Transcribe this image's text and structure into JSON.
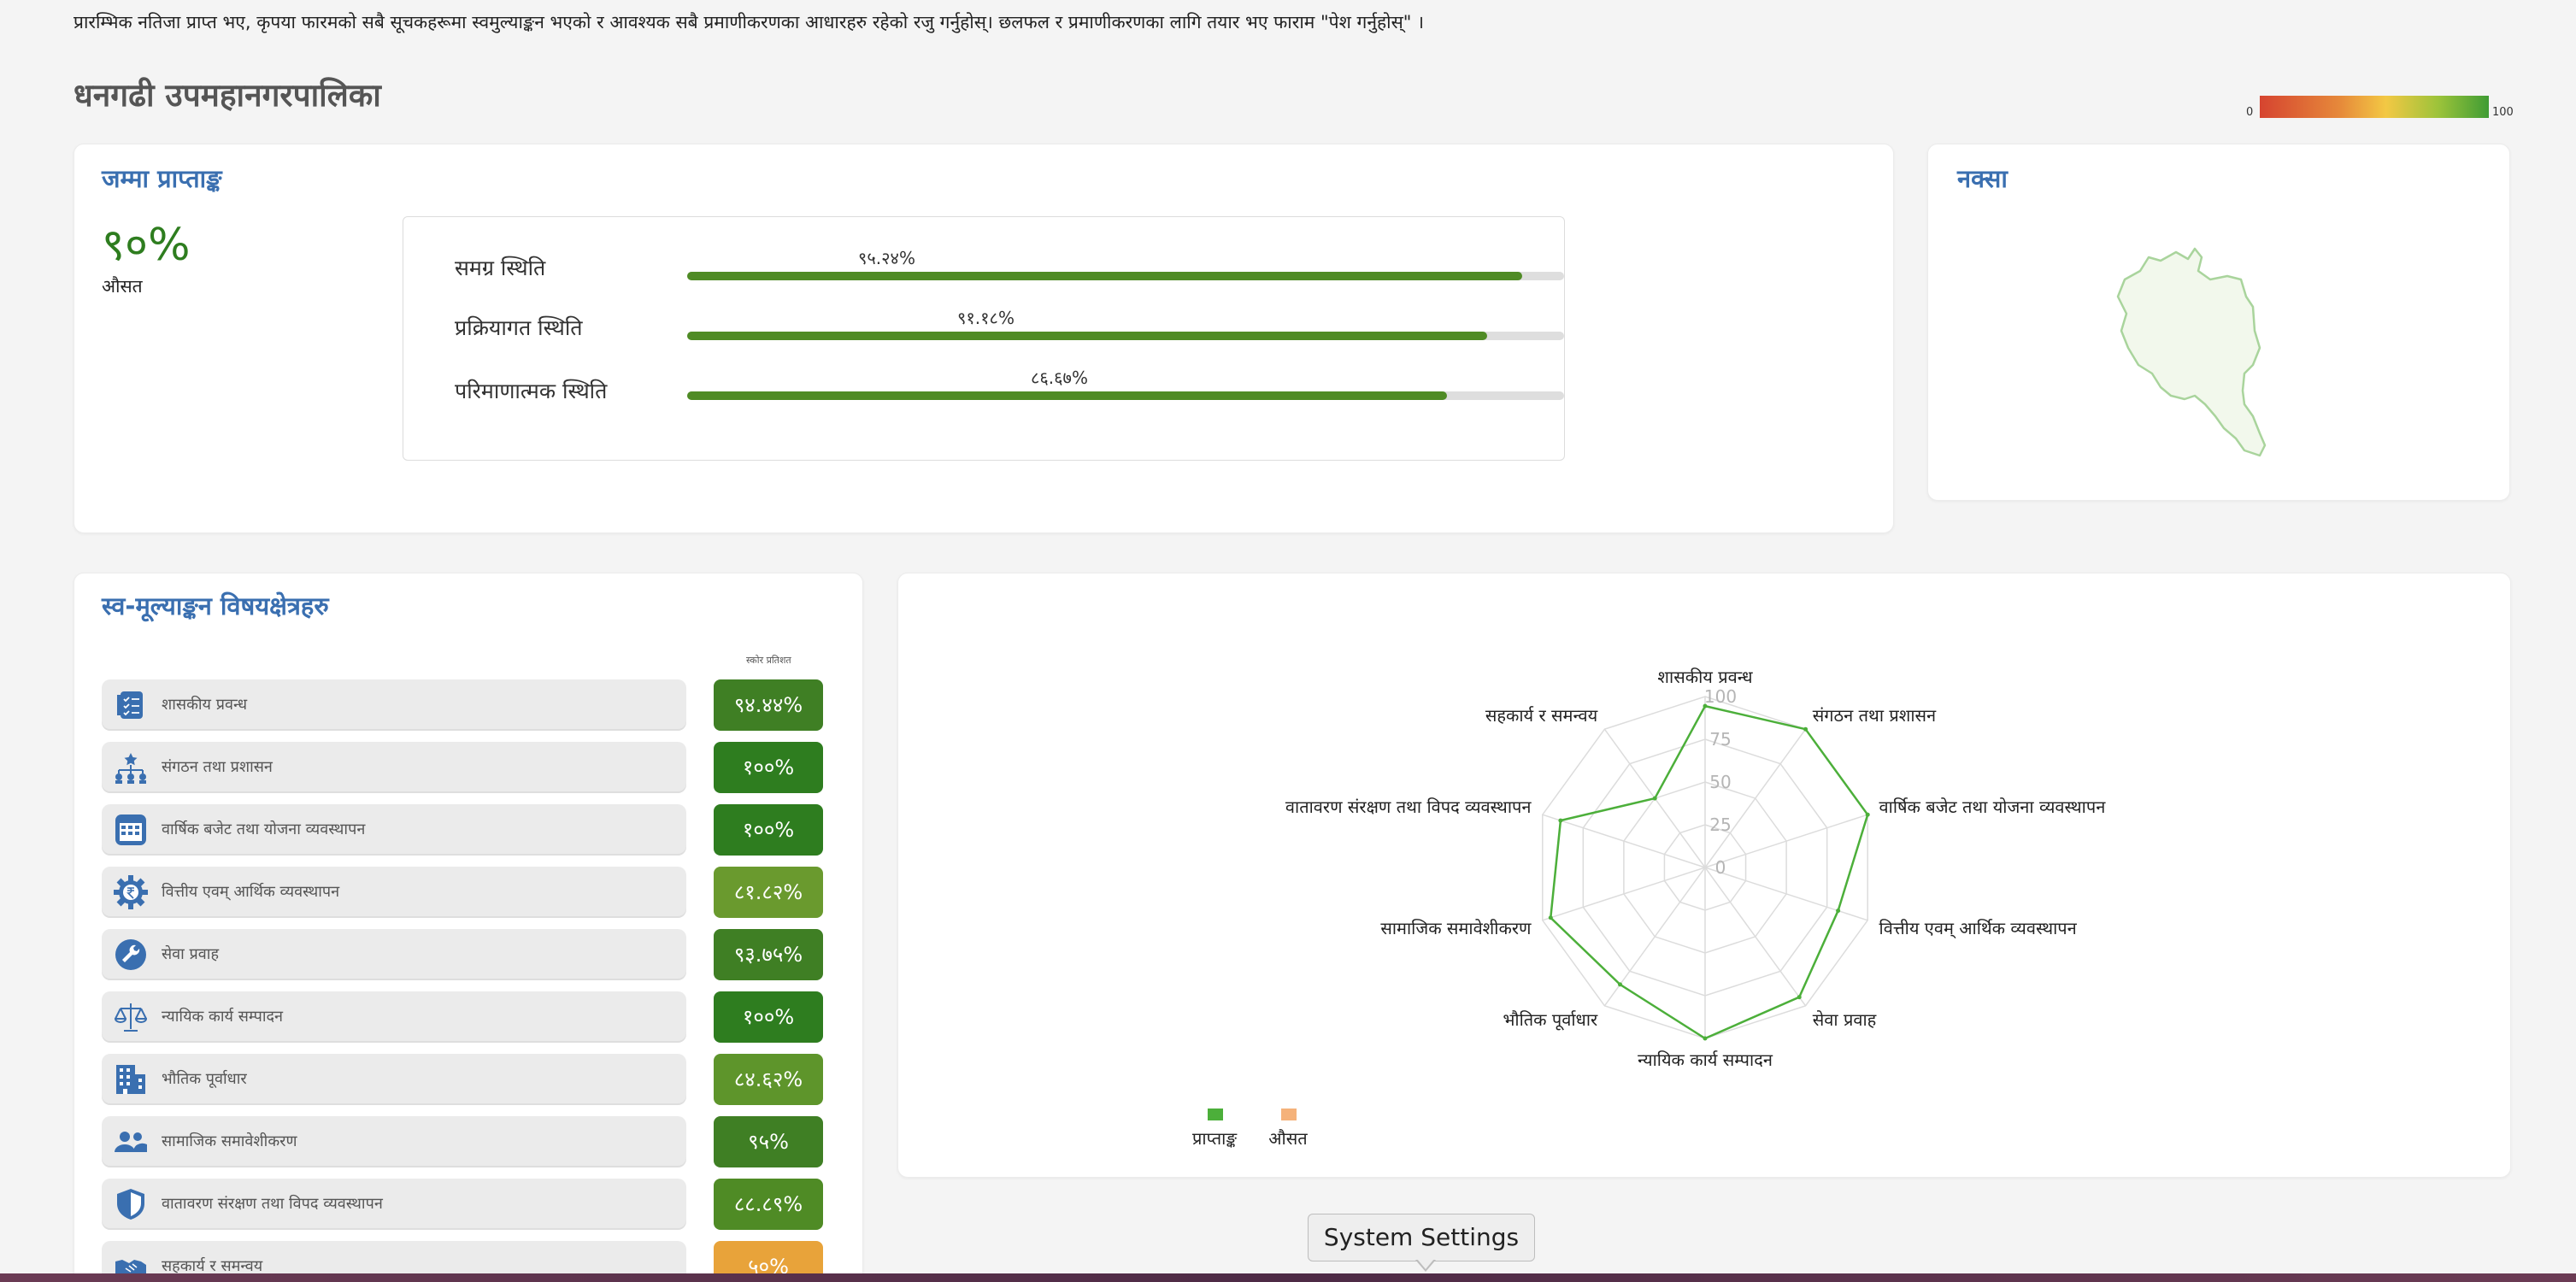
{
  "notice": "प्रारम्भिक नतिजा प्राप्त भए, कृपया फारमको सबै सूचकहरूमा स्वमुल्याङ्कन भएको र आवश्यक सबै प्रमाणीकरणका आधारहरु रहेको रजु गर्नुहोस्। छलफल र प्रमाणीकरणका लागि तयार भए फाराम \"पेश गर्नुहोस्\" ।",
  "page_title": "धनगढी उपमहानगरपालिका",
  "scale": {
    "min_label": "0",
    "max_label": "100",
    "low_color": "#d64430",
    "high_color": "#3f9c34"
  },
  "total_card": {
    "title": "जम्मा प्राप्ताङ्क",
    "score": "९०%",
    "score_caption": "औसत",
    "bars": [
      {
        "label": "समग्र स्थिति",
        "value_text": "९५.२४%",
        "value": 95.24
      },
      {
        "label": "प्रक्रियागत स्थिति",
        "value_text": "९१.१८%",
        "value": 91.18
      },
      {
        "label": "परिमाणात्मक स्थिति",
        "value_text": "८६.६७%",
        "value": 86.67
      }
    ]
  },
  "map_card": {
    "title": "नक्सा"
  },
  "areas_card": {
    "title": "स्व-मूल्याङ्कन विषयक्षेत्रहरु",
    "column_header": "स्कोर प्रतिशत",
    "items": [
      {
        "label": "शासकीय प्रवन्ध",
        "score": "९४.४४%",
        "value": 94.44,
        "icon": "governance-checklist-icon",
        "color": "#3f7f24"
      },
      {
        "label": "संगठन तथा प्रशासन",
        "score": "१००%",
        "value": 100,
        "icon": "org-chart-icon",
        "color": "#2e7d1f"
      },
      {
        "label": "वार्षिक बजेट तथा योजना व्यवस्थापन",
        "score": "१००%",
        "value": 100,
        "icon": "calendar-icon",
        "color": "#2e7d1f"
      },
      {
        "label": "वित्तीय एवम् आर्थिक व्यवस्थापन",
        "score": "८१.८२%",
        "value": 81.82,
        "icon": "rupee-gear-icon",
        "color": "#6a9a2e"
      },
      {
        "label": "सेवा प्रवाह",
        "score": "९३.७५%",
        "value": 93.75,
        "icon": "wrench-icon",
        "color": "#3f7f24"
      },
      {
        "label": "न्यायिक कार्य सम्पादन",
        "score": "१००%",
        "value": 100,
        "icon": "scales-icon",
        "color": "#2e7d1f"
      },
      {
        "label": "भौतिक पूर्वाधार",
        "score": "८४.६२%",
        "value": 84.62,
        "icon": "building-icon",
        "color": "#5e952b"
      },
      {
        "label": "सामाजिक समावेशीकरण",
        "score": "९५%",
        "value": 95,
        "icon": "people-icon",
        "color": "#3f7f24"
      },
      {
        "label": "वातावरण संरक्षण तथा विपद व्यवस्थापन",
        "score": "८८.८९%",
        "value": 88.89,
        "icon": "shield-icon",
        "color": "#4f8b25"
      },
      {
        "label": "सहकार्य र समन्वय",
        "score": "५०%",
        "value": 50,
        "icon": "handshake-icon",
        "color": "#e8a33a"
      }
    ]
  },
  "chart_data": {
    "type": "radar",
    "axes": [
      "शासकीय प्रवन्ध",
      "संगठन तथा प्रशासन",
      "वार्षिक बजेट तथा योजना व्यवस्थापन",
      "वित्तीय एवम् आर्थिक व्यवस्थापन",
      "सेवा प्रवाह",
      "न्यायिक कार्य सम्पादन",
      "भौतिक पूर्वाधार",
      "सामाजिक समावेशीकरण",
      "वातावरण संरक्षण तथा विपद व्यवस्थापन",
      "सहकार्य र समन्वय"
    ],
    "rlim": [
      0,
      100
    ],
    "ticks": [
      "0",
      "25",
      "50",
      "75",
      "100"
    ],
    "tick_values": [
      0,
      25,
      50,
      75,
      100
    ],
    "series": [
      {
        "name": "प्राप्ताङ्क",
        "values": [
          94.44,
          100,
          100,
          81.82,
          93.75,
          100,
          84.62,
          95,
          88.89,
          50
        ],
        "color": "#4caf3a"
      },
      {
        "name": "औसत",
        "values": [],
        "color": "#f5b27a"
      }
    ],
    "legend": "bottom-left",
    "grid": true
  },
  "tooltip": {
    "text": "System Settings"
  }
}
